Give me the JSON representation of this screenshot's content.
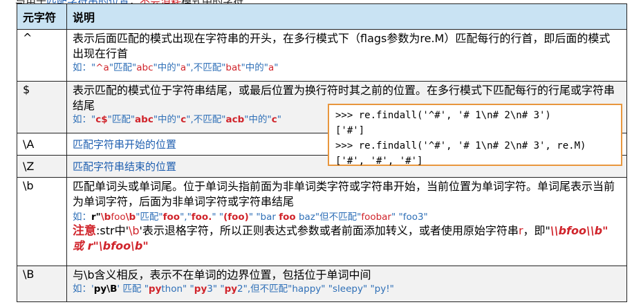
{
  "top_caption": {
    "part1": "与用于",
    "part2": "匹配字符串的位置",
    "part3": "，",
    "part4": "不会消耗",
    "part5": "模式中的字符"
  },
  "table": {
    "headers": [
      "元字符",
      "说明"
    ],
    "rows": [
      {
        "symbol": "^",
        "desc": "表示后面匹配的模式出现在字符串的开头，在多行模式下（flags参数为re.M）匹配每行的行首，即后面的模式出现在行首",
        "example": [
          "如：\"",
          "^a",
          "\"匹配\"",
          "abc",
          "\"中的\"",
          "a",
          "\",不匹配\"",
          "bat",
          "\"中的\"",
          "a",
          "\""
        ]
      },
      {
        "symbol": "$",
        "desc": "表示匹配的模式位于字符串结尾，或最后位置为换行符时其之前的位置。在多行模式下匹配每行的行尾或字符串结尾",
        "example": [
          "如：\"",
          "c$",
          "\"匹配\"",
          "ab",
          "c",
          "\"中的\"",
          "c",
          "\",不匹配\"",
          "acb",
          "\"中的\"",
          "c",
          "\""
        ]
      },
      {
        "symbol": "\\A",
        "desc": "匹配字符串开始的位置"
      },
      {
        "symbol": "\\Z",
        "desc": "匹配字符串结束的位置"
      },
      {
        "symbol": "\\b",
        "desc": "匹配单词头或单词尾。位于单词头指前面为非单词类字符或字符串开始，当前位置为单词字符。单词尾表示当前为单词字符，后面为非单词字符或字符串结尾",
        "example": [
          "如：",
          "r\"",
          "\\b",
          "foo",
          "\\b",
          "\"匹配\"",
          "foo",
          "\",\"",
          "foo.",
          "\" \"",
          "(foo)",
          "\" \"bar ",
          "foo",
          " baz\"但不匹配\"",
          "foobar",
          "\" \"foo3\""
        ],
        "note": [
          "注意",
          ":str中'",
          "\\b",
          "'表示退格字符，所以正则表达式参数或者前面添加转义，或者使用原始字符串",
          "r",
          "，即\"",
          "\\\\bfoo\\\\b",
          "\"  或 r\"",
          "\\bfoo\\b",
          "\""
        ]
      },
      {
        "symbol": "\\B",
        "desc": "与\\b含义相反，表示不在单词的边界位置，包括位于单词中间",
        "example": [
          "如：'",
          "py\\B",
          "' 匹配 \"",
          "py",
          "thon\" \"",
          "py",
          "3\" \"",
          "py",
          "2\",但不匹配\"happy\" \"sleepy\" \"py!\""
        ]
      }
    ]
  },
  "code": {
    "line1": ">>> re.findall('^#', '# 1\\n# 2\\n# 3')",
    "line2": "['#']",
    "line3": ">>> re.findall('^#', '# 1\\n# 2\\n# 3', re.M)",
    "line4": "['#', '#', '#']"
  }
}
